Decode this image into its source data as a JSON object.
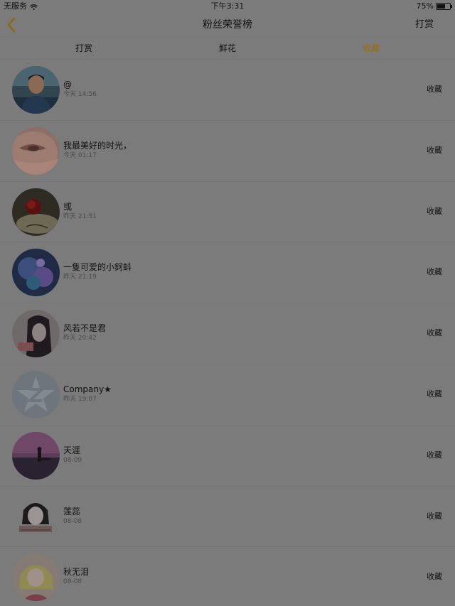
{
  "status_bar": {
    "carrier": "无服务",
    "time": "下午3:31",
    "battery_percent": "75%",
    "battery_level": 0.75
  },
  "nav": {
    "title": "粉丝荣誉榜",
    "right_label": "打赏",
    "back_icon": "chevron-left-icon"
  },
  "tabs": [
    {
      "label": "打赏",
      "active": false
    },
    {
      "label": "鲜花",
      "active": false
    },
    {
      "label": "收藏",
      "active": true
    }
  ],
  "colors": {
    "overlay_background": "#7b7b7b",
    "active_tab": "#9b6d08",
    "back_icon": "#8a6a10"
  },
  "fans": [
    {
      "name": "@",
      "time": "今天 14:56",
      "action": "收藏"
    },
    {
      "name": "我最美好的时光，",
      "time": "今天 01:17",
      "action": "收藏"
    },
    {
      "name": "或",
      "time": "昨天 21:51",
      "action": "收藏"
    },
    {
      "name": "一隻可爱的小鈳蚪",
      "time": "昨天 21:19",
      "action": "收藏"
    },
    {
      "name": "风若不是君",
      "time": "昨天 20:42",
      "action": "收藏"
    },
    {
      "name": "Company★",
      "time": "昨天 19:07",
      "action": "收藏"
    },
    {
      "name": "天涯",
      "time": "08-09",
      "action": "收藏"
    },
    {
      "name": "莲蕊",
      "time": "08-08",
      "action": "收藏"
    },
    {
      "name": "秋无泪",
      "time": "08-08",
      "action": "收藏"
    }
  ]
}
